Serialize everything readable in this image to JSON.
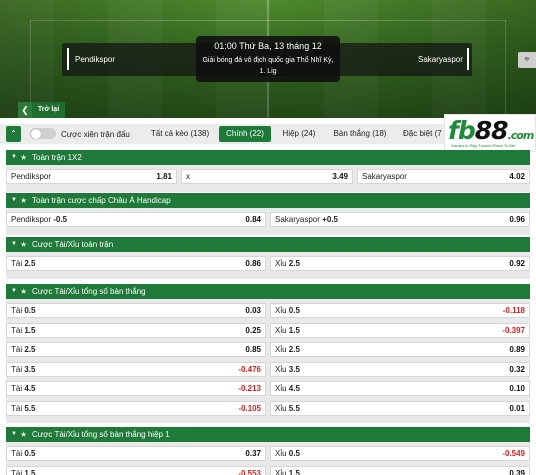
{
  "match": {
    "home_team": "Pendikspor",
    "away_team": "Sakaryaspor",
    "time": "01:00 Thứ Ba, 13 tháng 12",
    "league_line1": "Giải bóng đá vô địch quốc gia Thổ Nhĩ Kỳ,",
    "league_line2": "1. Lig"
  },
  "nav": {
    "back_label": "Trở lại",
    "back_icon": "chevron-left-icon",
    "pin_icon": "pin-icon"
  },
  "toolbar": {
    "toggle_label": "Cược xiên trận đấu",
    "tabs": [
      {
        "label": "Tất cả kèo (138)"
      },
      {
        "label": "Chính (22)"
      },
      {
        "label": "Hiệp (24)"
      },
      {
        "label": "Bàn thắng (18)"
      },
      {
        "label": "Đặc biệt (7"
      }
    ],
    "active_tab": "Chính (22)"
  },
  "logo": {
    "brand": "fb",
    "num": "88",
    "tld": ".com",
    "tagline": "Games to Play   Trusted Place To Bet"
  },
  "colors": {
    "accent": "#1f7a3a",
    "negative": "#d42020"
  },
  "markets": [
    {
      "title": "Toàn trận 1X2",
      "rows": [
        [
          {
            "label": "Pendikspor",
            "odd": "1.81"
          },
          {
            "label": "x",
            "odd": "3.49"
          },
          {
            "label": "Sakaryaspor",
            "odd": "4.02"
          }
        ]
      ]
    },
    {
      "title": "Toàn trận cược chấp Châu Á Handicap",
      "rows": [
        [
          {
            "label": "Pendikspor",
            "line": "-0.5",
            "odd": "0.84"
          },
          {
            "label": "Sakaryaspor",
            "line": "+0.5",
            "odd": "0.96"
          }
        ]
      ]
    },
    {
      "title": "Cược Tài/Xỉu toàn trận",
      "rows": [
        [
          {
            "label": "Tài",
            "line": "2.5",
            "odd": "0.86"
          },
          {
            "label": "Xỉu",
            "line": "2.5",
            "odd": "0.92"
          }
        ]
      ]
    },
    {
      "title": "Cược Tài/Xỉu tổng số bàn thắng",
      "rows": [
        [
          {
            "label": "Tài",
            "line": "0.5",
            "odd": "0.03"
          },
          {
            "label": "Xỉu",
            "line": "0.5",
            "odd": "-0.118"
          }
        ],
        [
          {
            "label": "Tài",
            "line": "1.5",
            "odd": "0.25"
          },
          {
            "label": "Xỉu",
            "line": "1.5",
            "odd": "-0.397"
          }
        ],
        [
          {
            "label": "Tài",
            "line": "2.5",
            "odd": "0.85"
          },
          {
            "label": "Xỉu",
            "line": "2.5",
            "odd": "0.89"
          }
        ],
        [
          {
            "label": "Tài",
            "line": "3.5",
            "odd": "-0.476"
          },
          {
            "label": "Xỉu",
            "line": "3.5",
            "odd": "0.32"
          }
        ],
        [
          {
            "label": "Tài",
            "line": "4.5",
            "odd": "-0.213"
          },
          {
            "label": "Xỉu",
            "line": "4.5",
            "odd": "0.10"
          }
        ],
        [
          {
            "label": "Tài",
            "line": "5.5",
            "odd": "-0.105"
          },
          {
            "label": "Xỉu",
            "line": "5.5",
            "odd": "0.01"
          }
        ]
      ]
    },
    {
      "title": "Cược Tài/Xỉu tổng số bàn thắng hiệp 1",
      "rows": [
        [
          {
            "label": "Tài",
            "line": "0.5",
            "odd": "0.37"
          },
          {
            "label": "Xỉu",
            "line": "0.5",
            "odd": "-0.549"
          }
        ],
        [
          {
            "label": "Tài",
            "line": "1.5",
            "odd": "-0.553"
          },
          {
            "label": "Xỉu",
            "line": "1.5",
            "odd": "0.39"
          }
        ]
      ]
    }
  ]
}
